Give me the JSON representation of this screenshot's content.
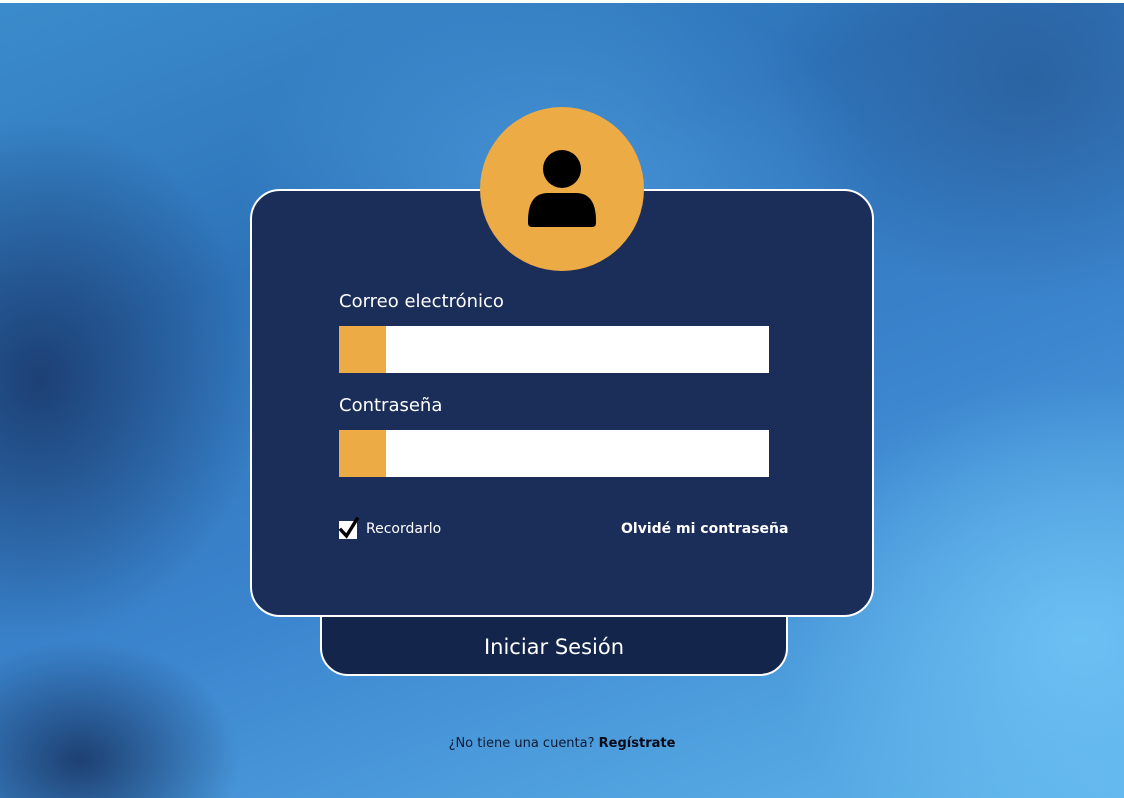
{
  "login": {
    "email_label": "Correo electrónico",
    "email_value": "",
    "password_label": "Contraseña",
    "password_value": "",
    "remember_label": "Recordarlo",
    "remember_checked": true,
    "forgot_label": "Olvidé mi contraseña",
    "submit_label": "Iniciar Sesión"
  },
  "footer": {
    "prompt": "¿No tiene una cuenta?",
    "register_link": "Regístrate"
  },
  "icons": {
    "avatar": "user-icon",
    "checkbox": "checkmark-icon"
  },
  "colors": {
    "card": "#1b2d59",
    "button": "#13254a",
    "accent": "#ecab45",
    "text": "#ffffff"
  }
}
